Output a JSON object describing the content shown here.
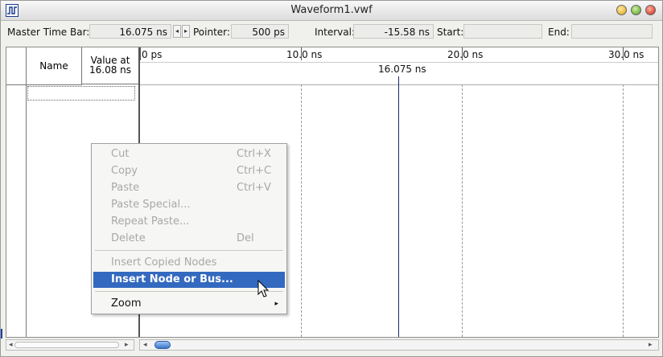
{
  "window": {
    "title": "Waveform1.vwf"
  },
  "toolbar": {
    "master_label": "Master Time Bar:",
    "master_value": "16.075 ns",
    "pointer_label": "Pointer:",
    "pointer_value": "500 ps",
    "interval_label": "Interval:",
    "interval_value": "-15.58 ns",
    "start_label": "Start:",
    "start_value": "",
    "end_label": "End:",
    "end_value": ""
  },
  "grid": {
    "name_header": "Name",
    "value_header_line1": "Value at",
    "value_header_line2": "16.08 ns",
    "ruler": [
      "0 ps",
      "10.0 ns",
      "20.0 ns",
      "30.0 ns"
    ],
    "cursor_label": "16.075 ns"
  },
  "context_menu": {
    "items": [
      {
        "label": "Cut",
        "shortcut": "Ctrl+X",
        "enabled": false
      },
      {
        "label": "Copy",
        "shortcut": "Ctrl+C",
        "enabled": false
      },
      {
        "label": "Paste",
        "shortcut": "Ctrl+V",
        "enabled": false
      },
      {
        "label": "Paste Special...",
        "shortcut": "",
        "enabled": false
      },
      {
        "label": "Repeat Paste...",
        "shortcut": "",
        "enabled": false
      },
      {
        "label": "Delete",
        "shortcut": "Del",
        "enabled": false
      },
      {
        "label": "Insert Copied Nodes",
        "shortcut": "",
        "enabled": false
      },
      {
        "label": "Insert Node or Bus...",
        "shortcut": "",
        "enabled": true,
        "selected": true
      },
      {
        "label": "Zoom",
        "shortcut": "",
        "enabled": true,
        "submenu": true
      }
    ]
  },
  "colors": {
    "selection": "#3369bf",
    "cursor_line": "#1c2a6a"
  }
}
